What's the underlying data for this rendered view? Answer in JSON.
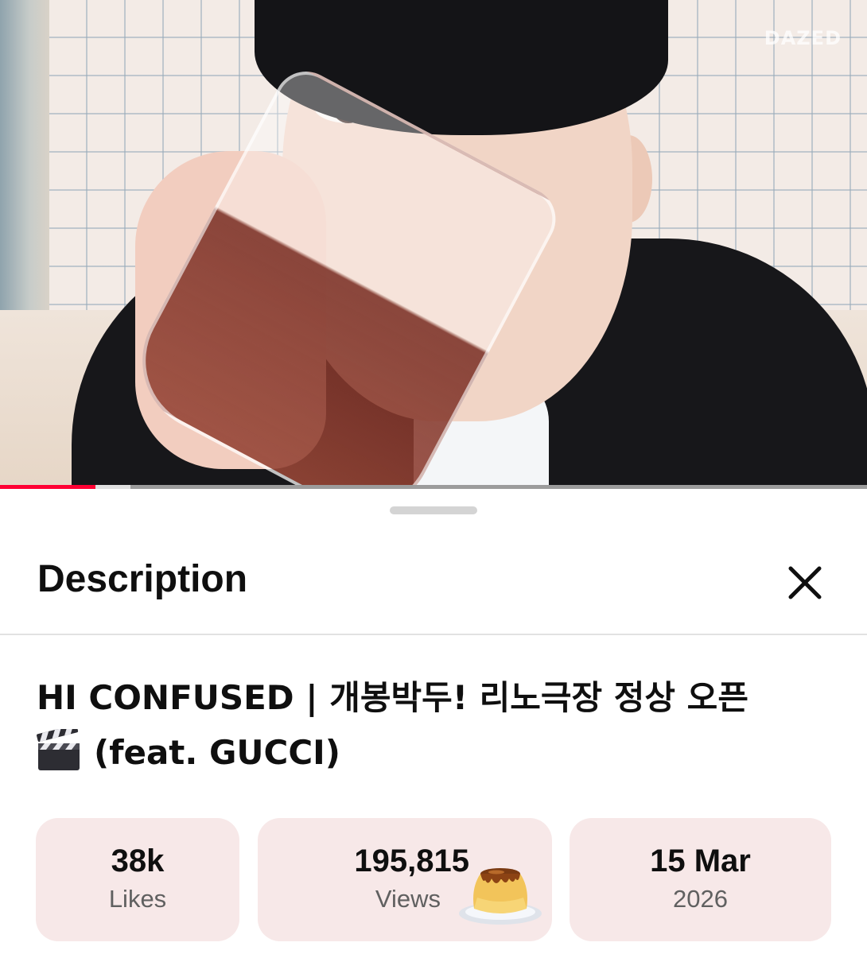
{
  "video": {
    "watermark": "DAZED",
    "progress_played_percent": 11,
    "progress_buffered_percent": 15
  },
  "sheet": {
    "title": "Description",
    "close_icon": "close-icon"
  },
  "description": {
    "title_line1": "HI CONFUSED | 개봉박두! 리노극장 정상 오픈",
    "title_line2": "(feat. GUCCI)",
    "title_emoji": "clapper-board-icon"
  },
  "stats": {
    "likes": {
      "value": "38k",
      "label": "Likes"
    },
    "views": {
      "value": "195,815",
      "label": "Views",
      "sticker": "pudding-icon"
    },
    "date": {
      "value": "15 Mar",
      "label": "2026"
    }
  },
  "colors": {
    "progress": "#ff0033",
    "stat_card_bg": "#f7e8e8",
    "stat_label": "#606060"
  }
}
